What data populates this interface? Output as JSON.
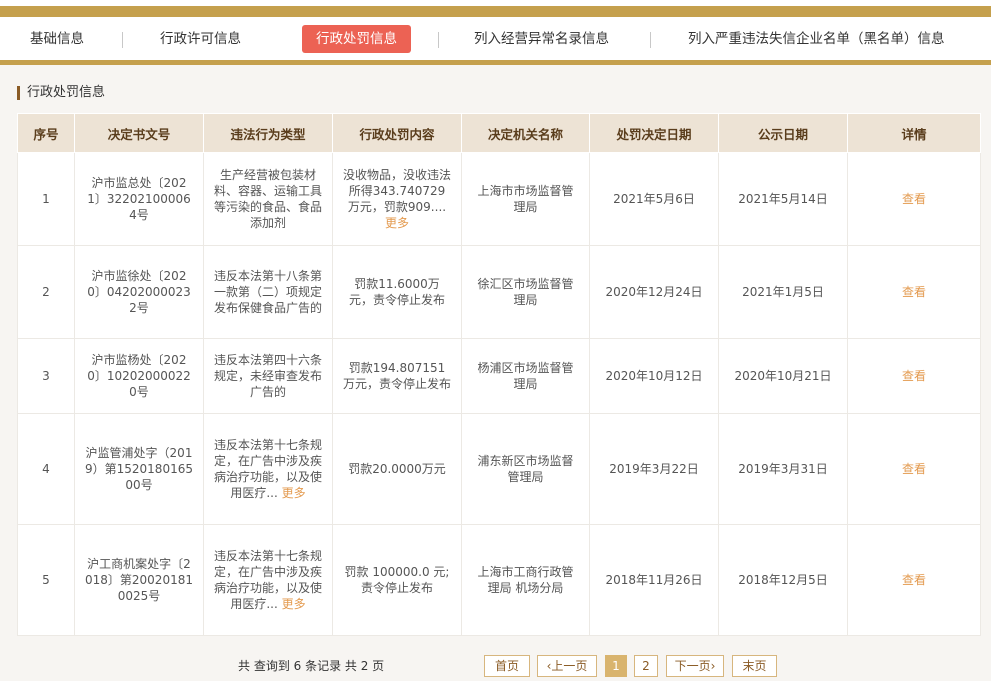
{
  "tabs": [
    {
      "label": "基础信息"
    },
    {
      "label": "行政许可信息"
    },
    {
      "label": "行政处罚信息"
    },
    {
      "label": "列入经营异常名录信息"
    },
    {
      "label": "列入严重违法失信企业名单（黑名单）信息"
    }
  ],
  "active_tab": "行政处罚信息",
  "section": {
    "title": "行政处罚信息"
  },
  "table": {
    "headers": [
      "序号",
      "决定书文号",
      "违法行为类型",
      "行政处罚内容",
      "决定机关名称",
      "处罚决定日期",
      "公示日期",
      "详情"
    ],
    "rows": [
      {
        "no": "1",
        "doc": "沪市监总处〔2021〕322021000064号",
        "type": "生产经营被包装材料、容器、运输工具等污染的食品、食品添加剂",
        "type_more": "",
        "content": "没收物品，没收违法所得343.740729万元，罚款909....",
        "content_more": "更多",
        "org": "上海市市场监督管理局",
        "decision_date": "2021年5月6日",
        "publish_date": "2021年5月14日",
        "detail": "查看"
      },
      {
        "no": "2",
        "doc": "沪市监徐处〔2020〕042020000232号",
        "type": "违反本法第十八条第一款第（二）项规定发布保健食品广告的",
        "type_more": "",
        "content": "罚款11.6000万元，责令停止发布",
        "content_more": "",
        "org": "徐汇区市场监督管理局",
        "decision_date": "2020年12月24日",
        "publish_date": "2021年1月5日",
        "detail": "查看"
      },
      {
        "no": "3",
        "doc": "沪市监杨处〔2020〕102020000220号",
        "type": "违反本法第四十六条规定，未经审查发布广告的",
        "type_more": "",
        "content": "罚款194.807151万元，责令停止发布",
        "content_more": "",
        "org": "杨浦区市场监督管理局",
        "decision_date": "2020年10月12日",
        "publish_date": "2020年10月21日",
        "detail": "查看"
      },
      {
        "no": "4",
        "doc": "沪监管浦处字（2019）第152018016500号",
        "type": "违反本法第十七条规定，在广告中涉及疾病治疗功能，以及使用医疗...",
        "type_more": "更多",
        "content": "罚款20.0000万元",
        "content_more": "",
        "org": "浦东新区市场监督管理局",
        "decision_date": "2019年3月22日",
        "publish_date": "2019年3月31日",
        "detail": "查看"
      },
      {
        "no": "5",
        "doc": "沪工商机案处字〔2018〕第200201810025号",
        "type": "违反本法第十七条规定，在广告中涉及疾病治疗功能，以及使用医疗...",
        "type_more": "更多",
        "content": "罚款 100000.0 元;责令停止发布",
        "content_more": "",
        "org": "上海市工商行政管理局 机场分局",
        "decision_date": "2018年11月26日",
        "publish_date": "2018年12月5日",
        "detail": "查看"
      }
    ]
  },
  "pagination": {
    "summary": "共 查询到 6 条记录 共 2 页",
    "first": "首页",
    "prev": "‹上一页",
    "pages": [
      "1",
      "2"
    ],
    "current_page": "1",
    "next": "下一页›",
    "last": "末页"
  },
  "colors": {
    "accent_gold": "#c5a04d",
    "active_tab": "#ec6254",
    "header_bg": "#ede3d5",
    "link": "#e39a4f"
  }
}
